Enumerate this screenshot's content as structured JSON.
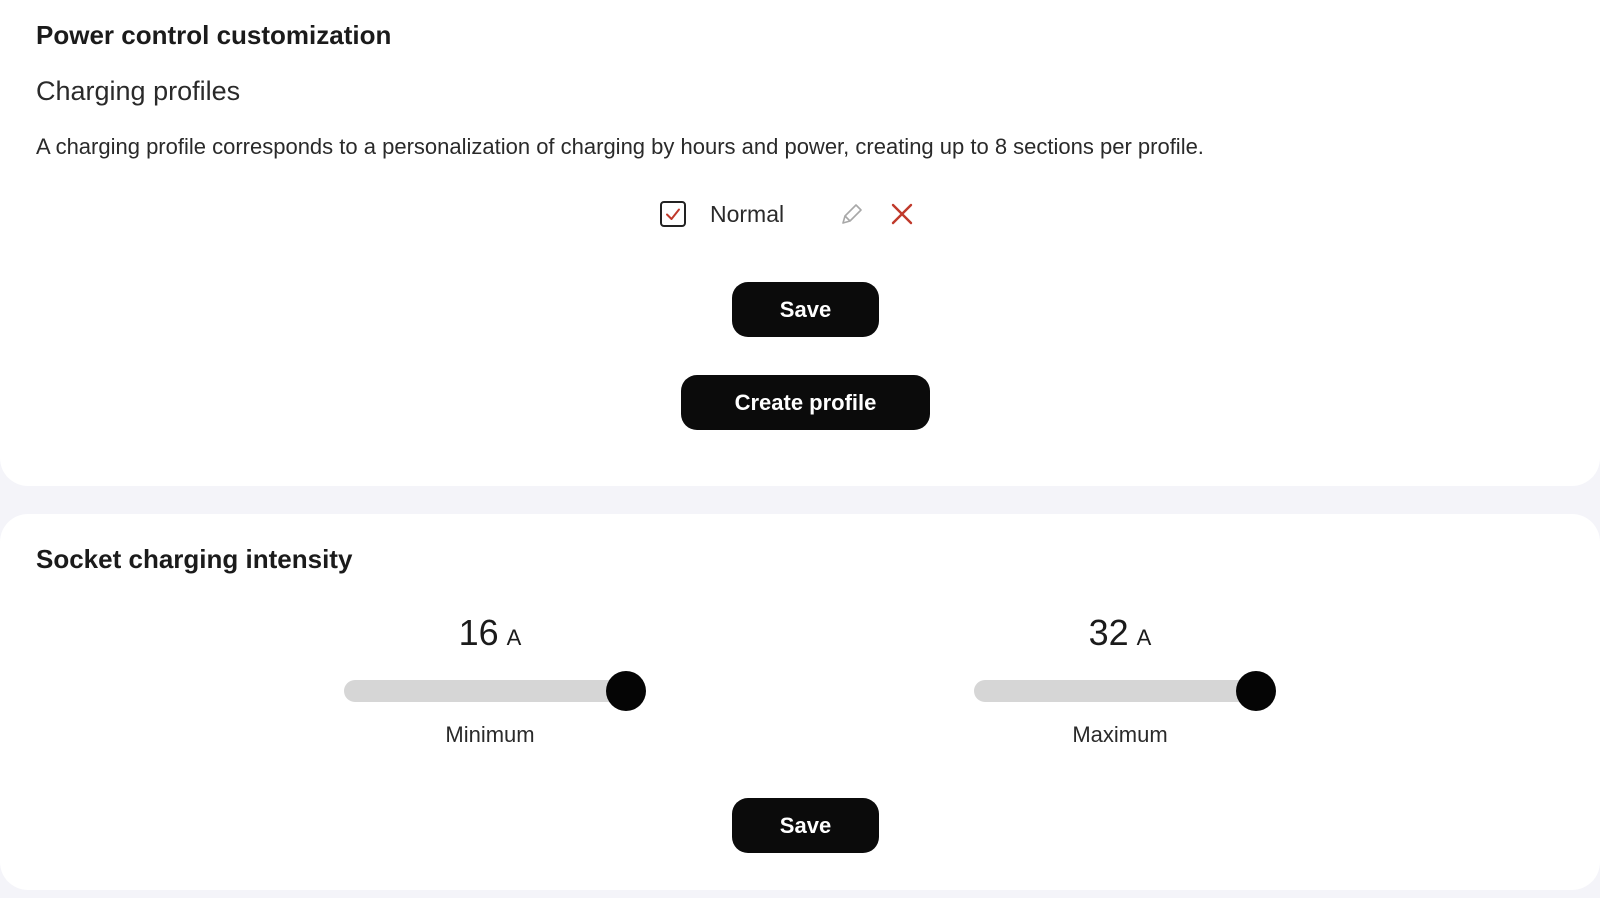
{
  "power_control": {
    "title": "Power control customization",
    "subtitle": "Charging profiles",
    "description": "A charging profile corresponds to a personalization of charging by hours and power, creating up to 8 sections per profile.",
    "profiles": [
      {
        "name": "Normal",
        "checked": true
      }
    ],
    "save_label": "Save",
    "create_profile_label": "Create profile"
  },
  "socket_intensity": {
    "title": "Socket charging intensity",
    "minimum": {
      "value": "16",
      "unit": "A",
      "label": "Minimum",
      "level": 0.94
    },
    "maximum": {
      "value": "32",
      "unit": "A",
      "label": "Maximum",
      "level": 0.94
    },
    "save_label": "Save"
  },
  "colors": {
    "button_bg": "#0b0b0b",
    "delete_icon": "#c0392b",
    "edit_icon": "#a8a8a8",
    "check_mark": "#c0392b",
    "track": "#d6d6d6",
    "page_bg": "#f4f4f9"
  },
  "icons": {
    "checkbox": "check-icon",
    "edit": "pencil-icon",
    "delete": "close-icon"
  }
}
